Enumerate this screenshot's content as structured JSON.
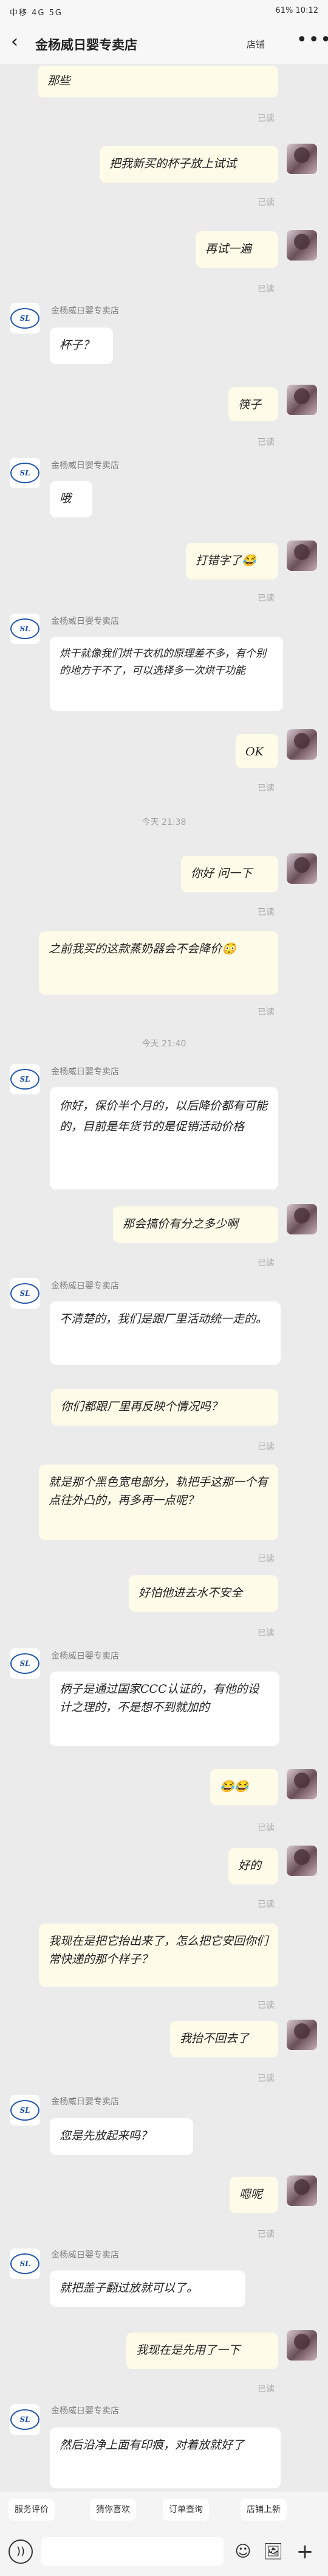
{
  "status_bar": {
    "left": "中移 4G 5G",
    "right": "61% 10:12"
  },
  "header": {
    "back_icon": "‹",
    "title": "金杨威日婴专卖店",
    "store_label": "店铺",
    "more_icon": "•••"
  },
  "read_label": "已读",
  "messages": [
    {
      "side": "mine",
      "text": "那些"
    },
    {
      "side": "mine",
      "text": "把我新买的杯子放上试试"
    },
    {
      "side": "mine",
      "text": "再试一遍"
    },
    {
      "side": "theirs",
      "sender": "金杨威日婴专卖店",
      "text": "杯子？"
    },
    {
      "side": "mine",
      "text": "筷子"
    },
    {
      "side": "theirs",
      "sender": "金杨威日婴专卖店",
      "text": "哦"
    },
    {
      "side": "mine",
      "text": "打错字了😂"
    },
    {
      "side": "theirs",
      "sender": "金杨威日婴专卖店",
      "text": "烘干就像我们烘干衣机的原理差不多，有个别的地方干不了，可以选择多一次烘干功能"
    },
    {
      "side": "mine",
      "text": "OK"
    },
    {
      "side": "mine",
      "text": "你好 问一下"
    },
    {
      "side": "mine",
      "text": "之前我买的这款蒸奶器会不会降价😳"
    },
    {
      "side": "theirs",
      "sender": "金杨威日婴专卖店",
      "text": "你好，保价半个月的，以后降价都有可能的，目前是年货节的是促销活动价格"
    },
    {
      "side": "mine",
      "text": "那会搞价有分之多少啊"
    },
    {
      "side": "theirs",
      "sender": "金杨威日婴专卖店",
      "text": "不清楚的，我们是跟厂里活动统一走的。"
    },
    {
      "side": "mine",
      "text": "你们都跟厂里再反映个情况吗？"
    },
    {
      "side": "mine",
      "text": "就是那个黑色宽电部分，轨把手这那一个有点往外凸的，再多再一点呢？"
    },
    {
      "side": "mine",
      "text": "好怕他进去水不安全"
    },
    {
      "side": "theirs",
      "sender": "金杨威日婴专卖店",
      "text": "柄子是通过国家CCC认证的，有他的设计之理的，不是想不到就加的"
    },
    {
      "side": "mine",
      "text": "😂😂"
    },
    {
      "side": "mine",
      "text": "好的"
    },
    {
      "side": "mine",
      "text": "我现在是把它抬出来了，怎么把它安回你们常快递的那个样子？"
    },
    {
      "side": "mine",
      "text": "我抬不回去了"
    },
    {
      "side": "theirs",
      "sender": "金杨威日婴专卖店",
      "text": "您是先放起来吗？"
    },
    {
      "side": "mine",
      "text": "嗯呢"
    },
    {
      "side": "theirs",
      "sender": "金杨威日婴专卖店",
      "text": "就把盖子翻过放就可以了。"
    },
    {
      "side": "mine",
      "text": "我现在是先用了一下"
    },
    {
      "side": "theirs",
      "sender": "金杨威日婴专卖店",
      "text": "然后沿净上面有印痕，对着放就好了"
    }
  ],
  "timestamps": [
    "今天 21:38",
    "今天 21:40"
  ],
  "quick_actions": [
    "服务评价",
    "猜你喜欢",
    "订单查询",
    "店铺上新"
  ],
  "input_icons": {
    "voice": "))",
    "emoji": "☺",
    "image": "🖼",
    "plus": "+"
  }
}
